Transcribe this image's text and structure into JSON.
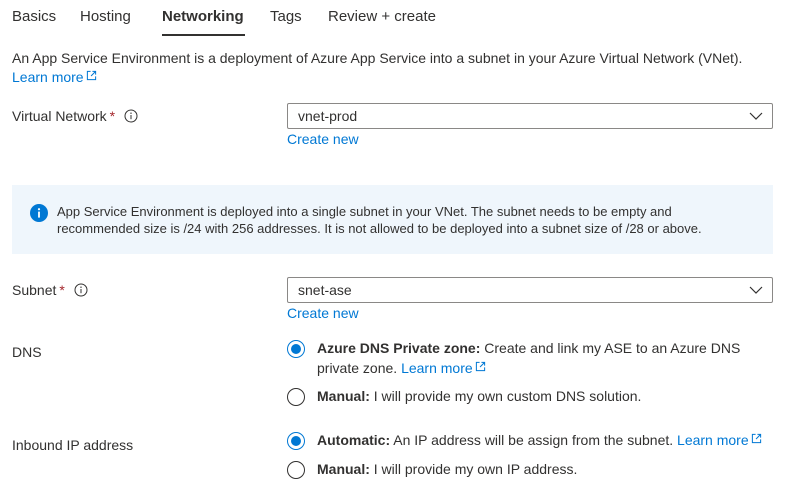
{
  "tabs": [
    {
      "label": "Basics",
      "active": false
    },
    {
      "label": "Hosting",
      "active": false
    },
    {
      "label": "Networking",
      "active": true
    },
    {
      "label": "Tags",
      "active": false
    },
    {
      "label": "Review + create",
      "active": false
    }
  ],
  "intro": {
    "text": "An App Service Environment is a deployment of Azure App Service into a subnet in your Azure Virtual Network (VNet).",
    "link": "Learn more"
  },
  "virtual_network": {
    "label": "Virtual Network",
    "required_marker": "*",
    "value": "vnet-prod",
    "create_new": "Create new"
  },
  "info_banner": {
    "text": "App Service Environment is deployed into a single subnet in your VNet. The subnet needs to be empty and recommended size is /24 with 256 addresses. It is not allowed to be deployed into a subnet size of /28 or above."
  },
  "subnet": {
    "label": "Subnet",
    "required_marker": "*",
    "value": "snet-ase",
    "create_new": "Create new"
  },
  "dns": {
    "label": "DNS",
    "options": [
      {
        "title": "Azure DNS Private zone:",
        "text": "Create and link my ASE to an Azure DNS private zone.",
        "link": "Learn more",
        "selected": true
      },
      {
        "title": "Manual:",
        "text": "I will provide my own custom DNS solution.",
        "link": "",
        "selected": false
      }
    ]
  },
  "inbound_ip": {
    "label": "Inbound IP address",
    "options": [
      {
        "title": "Automatic:",
        "text": "An IP address will be assign from the subnet.",
        "link": "Learn more",
        "selected": true
      },
      {
        "title": "Manual:",
        "text": "I will provide my own IP address.",
        "link": "",
        "selected": false
      }
    ]
  },
  "colors": {
    "accent": "#0078d4",
    "required": "#a4262c",
    "info_background": "#eff6fc",
    "text": "#323130"
  },
  "icons": {
    "info_tooltip": "info-circle-outline-icon",
    "banner": "info-filled-icon",
    "dropdown": "chevron-down-icon",
    "external_link": "external-link-icon"
  }
}
